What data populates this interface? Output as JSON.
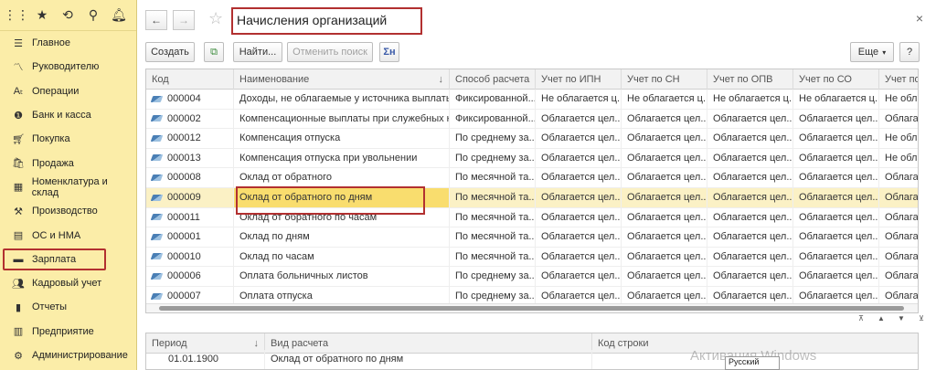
{
  "sidebar": {
    "top_icons": [
      {
        "icon": "apps-grid-icon",
        "glyph": "⋮⋮"
      },
      {
        "icon": "star-icon",
        "glyph": "★"
      },
      {
        "icon": "history-icon",
        "glyph": "⟲"
      },
      {
        "icon": "search-icon",
        "glyph": "⚲"
      },
      {
        "icon": "bell-icon",
        "glyph": "🔔︎"
      }
    ],
    "items": [
      {
        "label": "Главное",
        "icon": "menu-icon",
        "glyph": "☰"
      },
      {
        "label": "Руководителю",
        "icon": "chart-icon",
        "glyph": "〽"
      },
      {
        "label": "Операции",
        "icon": "operations-icon",
        "glyph": "Aₜ"
      },
      {
        "label": "Банк и касса",
        "icon": "bank-icon",
        "glyph": "❶"
      },
      {
        "label": "Покупка",
        "icon": "cart-icon",
        "glyph": "🛒︎"
      },
      {
        "label": "Продажа",
        "icon": "sale-icon",
        "glyph": "🛍︎"
      },
      {
        "label": "Номенклатура и склад",
        "icon": "warehouse-icon",
        "glyph": "▦"
      },
      {
        "label": "Производство",
        "icon": "factory-icon",
        "glyph": "⚒"
      },
      {
        "label": "ОС и НМА",
        "icon": "assets-icon",
        "glyph": "▤"
      },
      {
        "label": "Зарплата",
        "icon": "salary-icon",
        "glyph": "▬"
      },
      {
        "label": "Кадровый учет",
        "icon": "people-icon",
        "glyph": "👥︎"
      },
      {
        "label": "Отчеты",
        "icon": "reports-icon",
        "glyph": "▮"
      },
      {
        "label": "Предприятие",
        "icon": "enterprise-icon",
        "glyph": "▥"
      },
      {
        "label": "Администрирование",
        "icon": "gear-icon",
        "glyph": "⚙"
      }
    ],
    "selected_index": 9
  },
  "header": {
    "title": "Начисления организаций",
    "back_glyph": "←",
    "forward_glyph": "→",
    "star_glyph": "☆",
    "close_glyph": "×"
  },
  "toolbar": {
    "create": "Создать",
    "find": "Найти...",
    "cancel_search": "Отменить поиск",
    "sum_glyph": "Σн",
    "more": "Еще",
    "more_arrow": "▾",
    "help": "?",
    "copy_glyph": "⧉"
  },
  "grid": {
    "columns": [
      "Код",
      "Наименование",
      "Способ расчета",
      "Учет по ИПН",
      "Учет по СН",
      "Учет по ОПВ",
      "Учет по СО",
      "Учет по"
    ],
    "sort_glyph": "↓",
    "rows": [
      [
        "000004",
        "Доходы, не облагаемые у источника выплаты",
        "Фиксированной...",
        "Не облагается ц...",
        "Не облагается ц...",
        "Не облагается ц...",
        "Не облагается ц...",
        "Не обла"
      ],
      [
        "000002",
        "Компенсационные выплаты при служебных ко...",
        "Фиксированной...",
        "Облагается цел...",
        "Облагается цел...",
        "Облагается цел...",
        "Облагается цел...",
        "Облагае"
      ],
      [
        "000012",
        "Компенсация отпуска",
        "По среднему за...",
        "Облагается цел...",
        "Облагается цел...",
        "Облагается цел...",
        "Облагается цел...",
        "Не обла"
      ],
      [
        "000013",
        "Компенсация отпуска при увольнении",
        "По среднему за...",
        "Облагается цел...",
        "Облагается цел...",
        "Облагается цел...",
        "Облагается цел...",
        "Не обла"
      ],
      [
        "000008",
        "Оклад от обратного",
        "По месячной та...",
        "Облагается цел...",
        "Облагается цел...",
        "Облагается цел...",
        "Облагается цел...",
        "Облагае"
      ],
      [
        "000009",
        "Оклад от обратного по дням",
        "По месячной та...",
        "Облагается цел...",
        "Облагается цел...",
        "Облагается цел...",
        "Облагается цел...",
        "Облагае"
      ],
      [
        "000011",
        "Оклад от обратного по часам",
        "По месячной та...",
        "Облагается цел...",
        "Облагается цел...",
        "Облагается цел...",
        "Облагается цел...",
        "Облагае"
      ],
      [
        "000001",
        "Оклад по дням",
        "По месячной та...",
        "Облагается цел...",
        "Облагается цел...",
        "Облагается цел...",
        "Облагается цел...",
        "Облагае"
      ],
      [
        "000010",
        "Оклад по часам",
        "По месячной та...",
        "Облагается цел...",
        "Облагается цел...",
        "Облагается цел...",
        "Облагается цел...",
        "Облагае"
      ],
      [
        "000006",
        "Оплата больничных листов",
        "По среднему за...",
        "Облагается цел...",
        "Облагается цел...",
        "Облагается цел...",
        "Облагается цел...",
        "Облагае"
      ],
      [
        "000007",
        "Оплата отпуска",
        "По среднему за...",
        "Облагается цел...",
        "Облагается цел...",
        "Облагается цел...",
        "Облагается цел...",
        "Облагае"
      ]
    ],
    "selected_row": 5,
    "nav_glyphs": [
      "⊼",
      "▲",
      "▼",
      "⊻"
    ]
  },
  "lower": {
    "columns": [
      "Период",
      "Вид расчета",
      "Код строки"
    ],
    "sort_glyph": "↓",
    "row": [
      "01.01.1900",
      "Оклад от обратного по дням"
    ]
  },
  "overlay": {
    "watermark": "Активация Windows",
    "language": "Русский"
  }
}
